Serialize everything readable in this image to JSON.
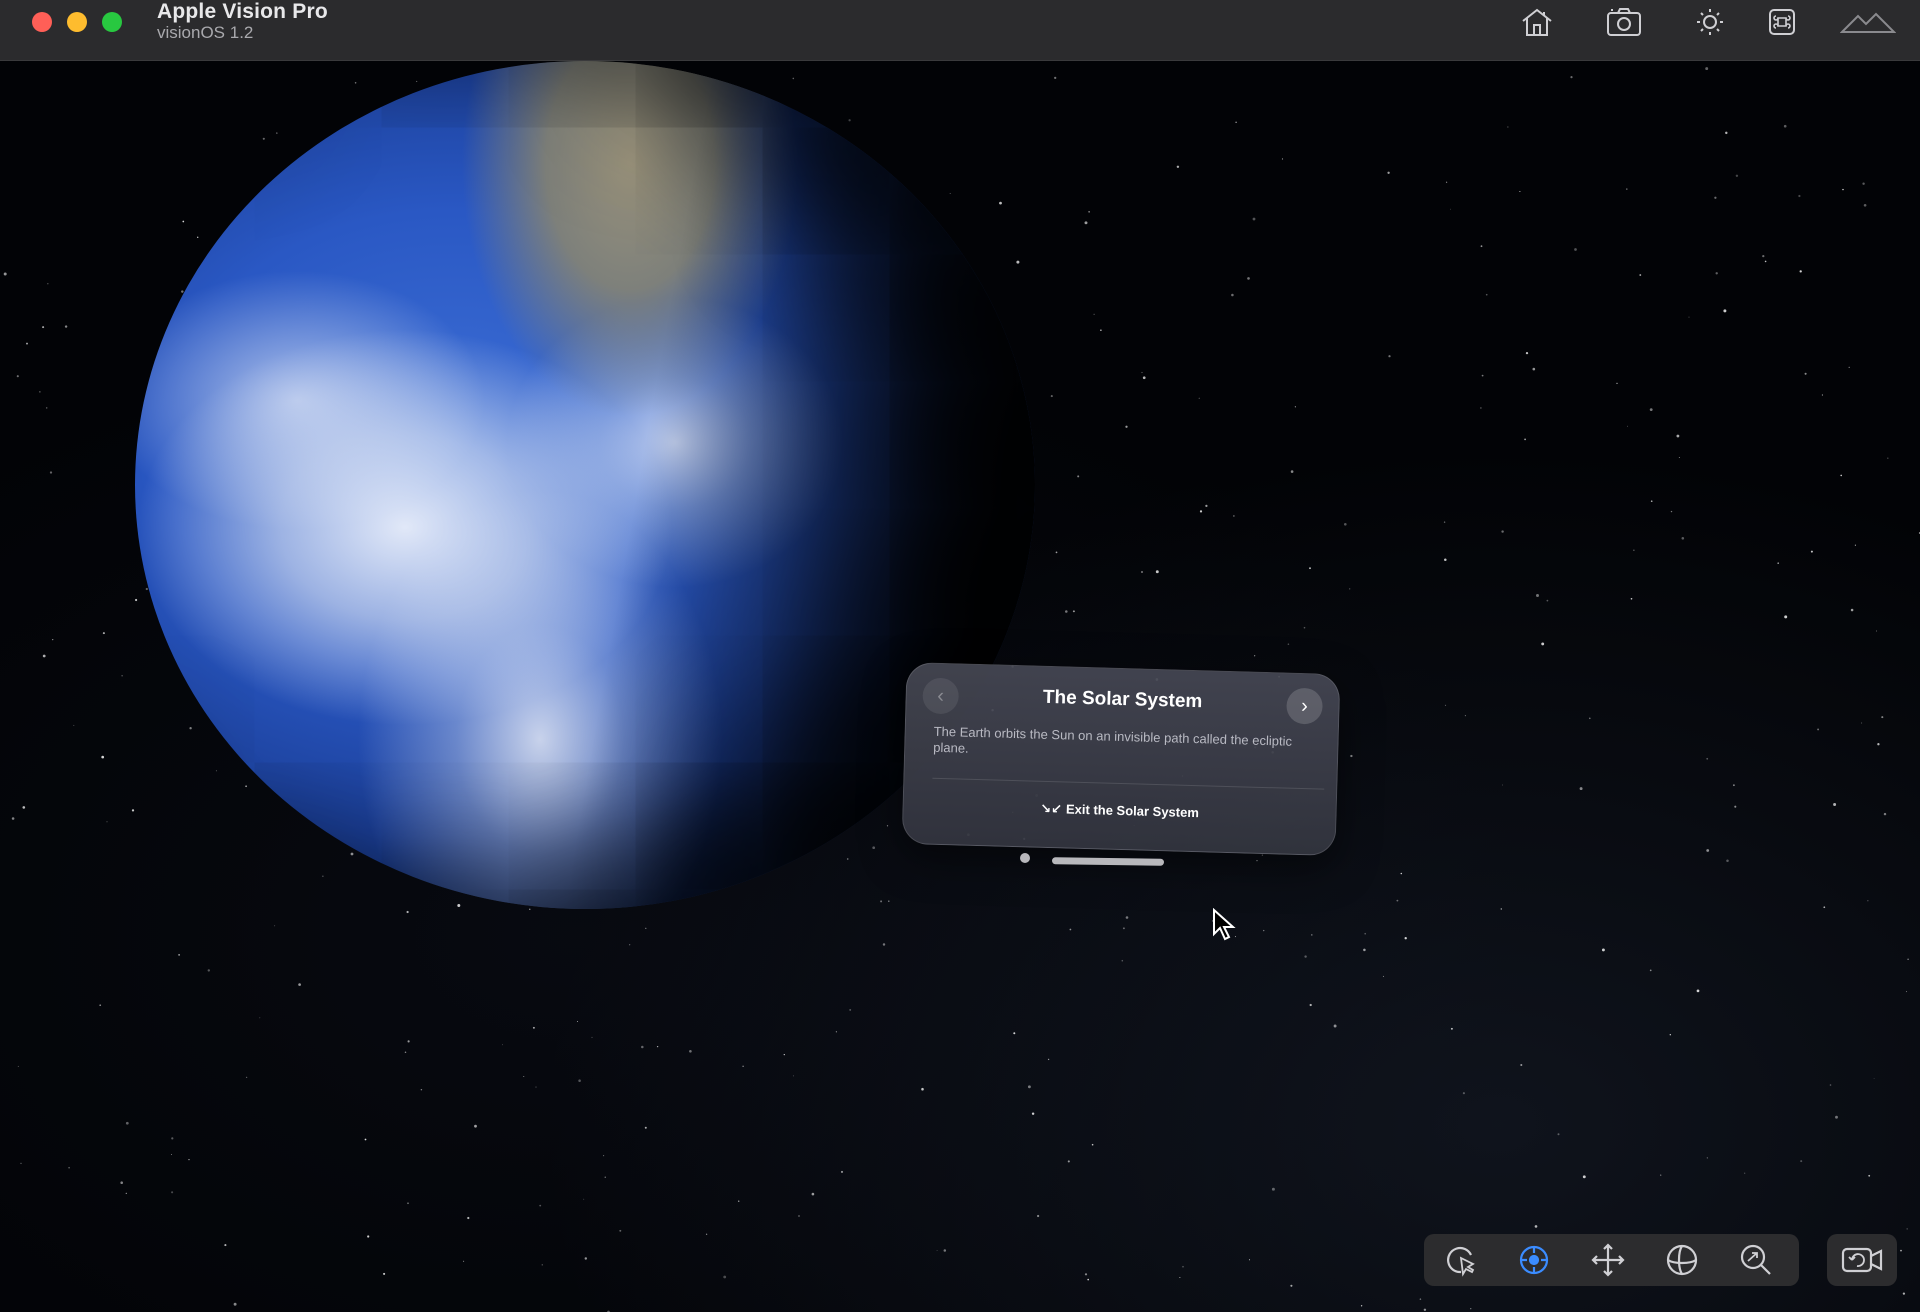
{
  "window": {
    "title": "Apple Vision Pro",
    "subtitle": "visionOS 1.2"
  },
  "titlebar_icons": [
    "home-icon",
    "camera-icon",
    "brightness-icon",
    "command-icon",
    "environment-icon"
  ],
  "card": {
    "title": "The Solar System",
    "prev_icon": "‹",
    "next_icon": "›",
    "body": "The Earth orbits the Sun on an invisible path called the ecliptic plane.",
    "action_icon": "↘↙",
    "action_label": "Exit the Solar System"
  },
  "toolbar": {
    "tools": [
      "select-icon",
      "orbit-icon",
      "pan-icon",
      "rotate-icon",
      "zoom-icon"
    ],
    "active_tool": "orbit-icon",
    "camera_button": "camera-reset-icon"
  },
  "colors": {
    "accent": "#3b8cff",
    "titlebar": "#2b2b2d",
    "close": "#ff5f57",
    "minimize": "#febc2e",
    "maximize": "#28c840"
  }
}
